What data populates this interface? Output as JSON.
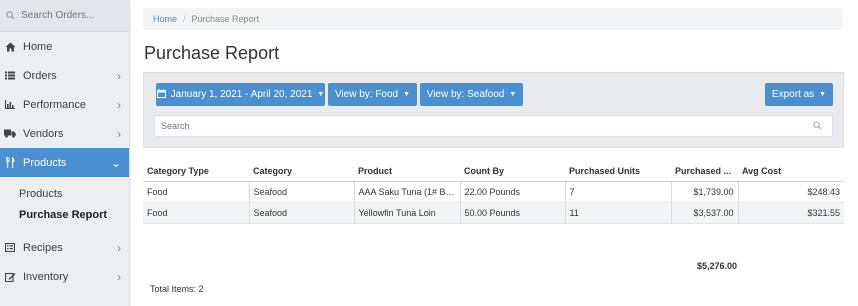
{
  "sidebar": {
    "search_placeholder": "Search Orders...",
    "items": [
      {
        "label": "Home",
        "icon": "home-icon",
        "has_chevron": false
      },
      {
        "label": "Orders",
        "icon": "list-icon",
        "has_chevron": true
      },
      {
        "label": "Performance",
        "icon": "bar-chart-icon",
        "has_chevron": true
      },
      {
        "label": "Vendors",
        "icon": "truck-icon",
        "has_chevron": true
      },
      {
        "label": "Products",
        "icon": "utensils-icon",
        "has_chevron": true,
        "active": true
      }
    ],
    "sub_items": [
      {
        "label": "Products"
      },
      {
        "label": "Purchase Report",
        "active": true
      }
    ],
    "items_after": [
      {
        "label": "Recipes",
        "icon": "book-icon",
        "has_chevron": true
      },
      {
        "label": "Inventory",
        "icon": "edit-icon",
        "has_chevron": true
      }
    ]
  },
  "breadcrumb": {
    "home": "Home",
    "separator": "/",
    "current": "Purchase Report"
  },
  "page_title": "Purchase Report",
  "filters": {
    "date_range": "January 1, 2021 - April 20, 2021",
    "view_by_1": "View by: Food",
    "view_by_2": "View by: Seafood",
    "export": "Export as",
    "search_placeholder": "Search"
  },
  "table": {
    "columns": [
      "Category Type",
      "Category",
      "Product",
      "Count By",
      "Purchased Units",
      "Purchased ...",
      "Avg Cost"
    ],
    "rows": [
      [
        "Food",
        "Seafood",
        "AAA Saku Tuna (1# BL...",
        "22.00 Pounds",
        "7",
        "$1,739.00",
        "$248.43"
      ],
      [
        "Food",
        "Seafood",
        "Yellowfin Tuna Loin",
        "50.00 Pounds",
        "11",
        "$3,537.00",
        "$321.55"
      ]
    ],
    "grand_total": "$5,276.00",
    "total_items": "Total Items: 2"
  },
  "colors": {
    "accent": "#4a8fd0",
    "sidebar_bg": "#eceef1",
    "panel_bg": "#e9ebee"
  }
}
